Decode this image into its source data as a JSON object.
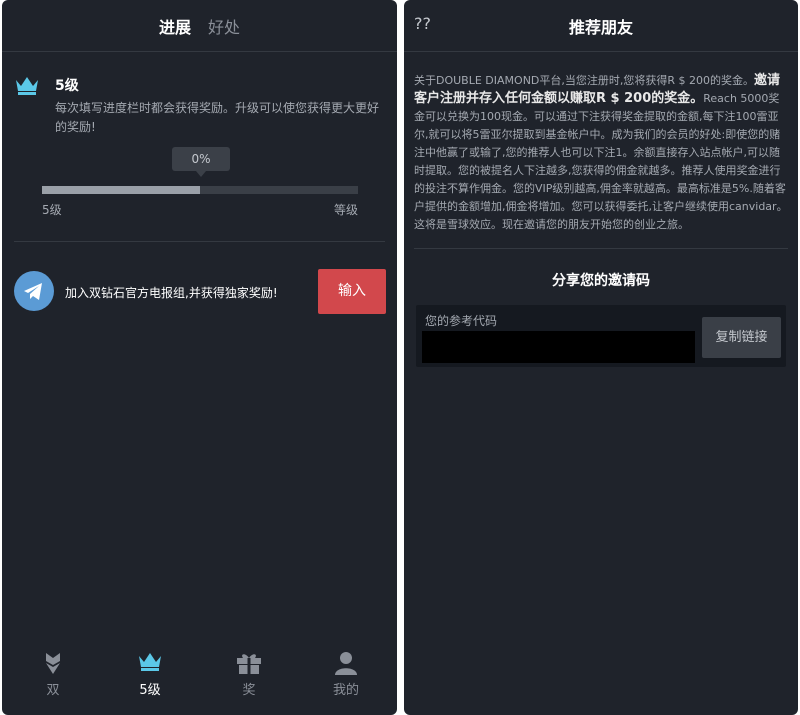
{
  "left": {
    "tabs": [
      {
        "label": "进展",
        "active": true
      },
      {
        "label": "好处",
        "active": false
      }
    ],
    "level": {
      "icon": "crown-icon",
      "title": "5级",
      "description": "每次填写进度栏时都会获得奖励。升级可以使您获得更大更好的奖励!"
    },
    "progress": {
      "label": "0%",
      "fill_fraction": 0.5,
      "start_label": "5级",
      "end_label": "等级"
    },
    "telegram": {
      "icon": "telegram-icon",
      "text": "加入双钻石官方电报组,并获得独家奖励!",
      "button_label": "输入"
    },
    "nav": [
      {
        "icon": "diamond-icon",
        "label": "双",
        "active": false
      },
      {
        "icon": "crown-icon",
        "label": "5级",
        "active": true
      },
      {
        "icon": "gift-icon",
        "label": "奖",
        "active": false
      },
      {
        "icon": "user-icon",
        "label": "我的",
        "active": false
      }
    ]
  },
  "right": {
    "back_label": "??",
    "title": "推荐朋友",
    "body": {
      "part1": "关于DOUBLE DIAMOND平台,当您注册时,您将获得R $ 200的奖金。",
      "highlight": "邀请客户注册并存入任何金额以赚取R $ 200的奖金。",
      "part2": "Reach 5000奖金可以兑换为100现金。可以通过下注获得奖金提取的金额,每下注100雷亚尔,就可以将5雷亚尔提取到基金帐户中。成为我们的会员的好处:即使您的赌注中他赢了或输了,您的推荐人也可以下注1。余额直接存入站点帐户,可以随时提取。您的被提名人下注越多,您获得的佣金就越多。推荐人使用奖金进行的投注不算作佣金。您的VIP级别越高,佣金率就越高。最高标准是5%.随着客户提供的金额增加,佣金将增加。您可以获得委托,让客户继续使用canvidar。 这将是雪球效应。现在邀请您的朋友开始您的创业之旅。"
    },
    "share_title": "分享您的邀请码",
    "referral": {
      "label": "您的参考代码",
      "value": "",
      "copy_label": "复制链接"
    }
  },
  "colors": {
    "background": "#1f232b",
    "accent_red": "#d2484c",
    "crown": "#5bc8e8",
    "telegram": "#5b9bd5"
  }
}
